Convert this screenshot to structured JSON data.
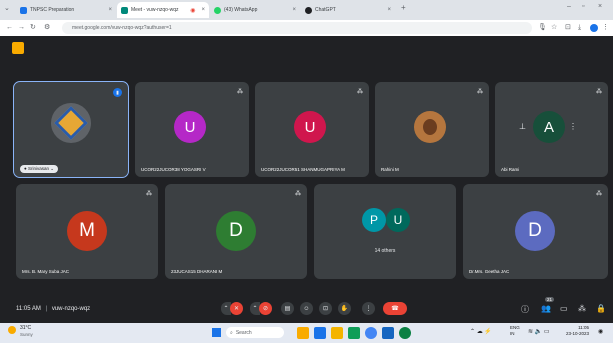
{
  "tabs": [
    {
      "title": "TNPSC Preparation",
      "color": "#1a73e8"
    },
    {
      "title": "Meet - vuw-nzqo-wqz",
      "color": "#00897b"
    },
    {
      "title": "(43) WhatsApp",
      "color": "#25d366"
    },
    {
      "title": "ChatGPT",
      "color": "#202124"
    }
  ],
  "address": {
    "url": "meet.google.com/vuw-nzqo-wqz?authuser=1"
  },
  "tiles": [
    {
      "name": "Srinivasan",
      "avatar_type": "image"
    },
    {
      "name": "UCOR22JUCOR38 YOGASRI V",
      "initial": "U",
      "color": "#b528c7"
    },
    {
      "name": "UCOR22JUCOR51 SHANMUGAPRIYA M",
      "initial": "U",
      "color": "#d0164d"
    },
    {
      "name": "Rahini M",
      "avatar_type": "photo"
    },
    {
      "name": "Abi Rami",
      "initial": "A",
      "color": "#174f3a"
    },
    {
      "name": "Mrs. B. Mary Suba JAC",
      "initial": "M",
      "color": "#c6381d"
    },
    {
      "name": "23JUCAS15 DHARANI M",
      "initial": "D",
      "color": "#2e7d32"
    },
    {
      "name": "14 others",
      "initial_a": "P",
      "initial_b": "U",
      "color_a": "#0097a7",
      "color_b": "#00695c"
    },
    {
      "name": "Dr.Mrs. Geetha JAC",
      "initial": "D",
      "color": "#5c6bc0"
    }
  ],
  "meeting": {
    "time": "11:05 AM",
    "code": "vuw-nzqo-wqz",
    "participants_badge": "21"
  },
  "taskbar": {
    "weather_temp": "31°C",
    "weather_desc": "Sunny",
    "search": "Search",
    "lang": "ENG",
    "region": "IN",
    "clock_time": "11:05",
    "clock_date": "23-10-2023"
  }
}
